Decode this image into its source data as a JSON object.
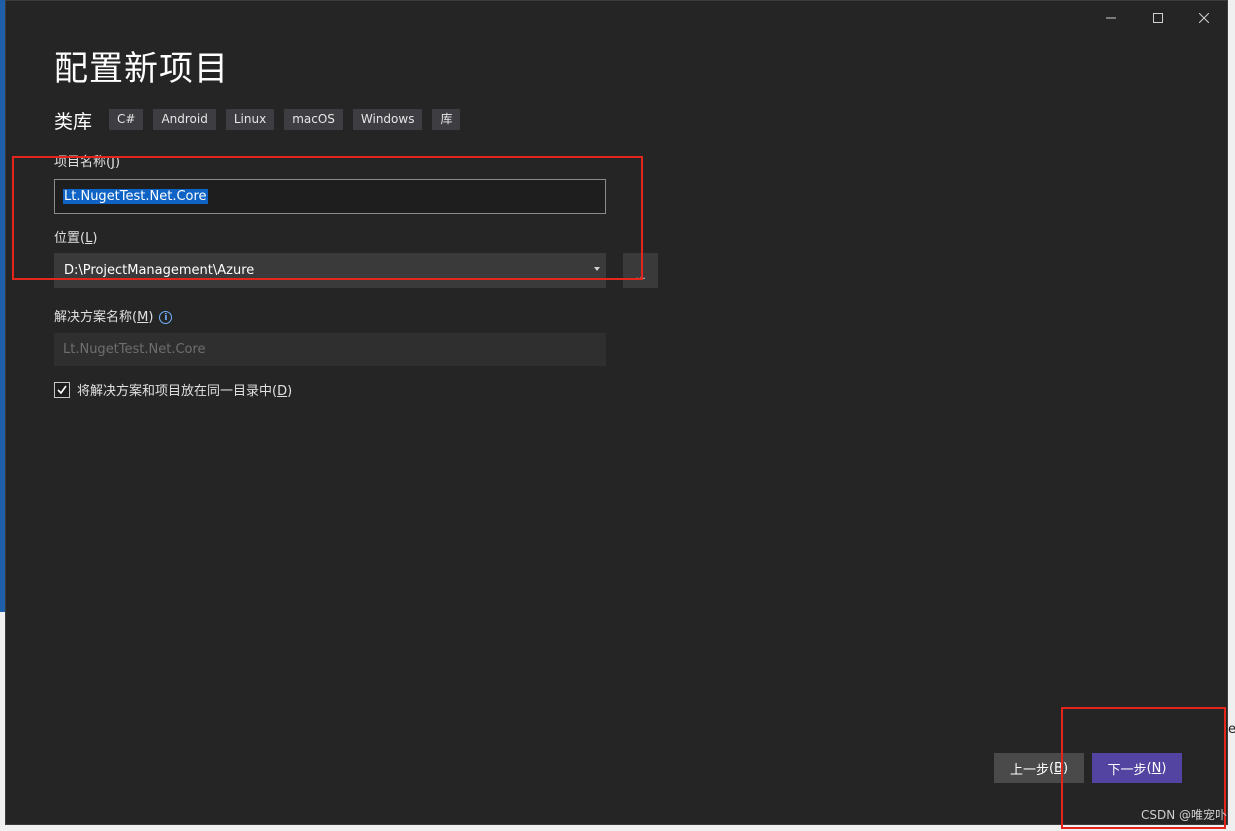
{
  "window": {
    "title": "配置新项目",
    "subtitle": "类库",
    "tags": [
      "C#",
      "Android",
      "Linux",
      "macOS",
      "Windows",
      "库"
    ]
  },
  "caption_buttons": {
    "minimize": "—",
    "maximize": "☐",
    "close": "✕"
  },
  "project_name": {
    "label": "项目名称",
    "mnemonic": "J",
    "value": "Lt.NugetTest.Net.Core"
  },
  "location": {
    "label": "位置",
    "mnemonic": "L",
    "value": "D:\\ProjectManagement\\Azure",
    "browse_label": "..."
  },
  "solution_name": {
    "label": "解决方案名称",
    "mnemonic": "M",
    "value": "Lt.NugetTest.Net.Core",
    "info_glyph": "i"
  },
  "same_directory": {
    "label": "将解决方案和项目放在同一目录中",
    "mnemonic": "D",
    "checked": true
  },
  "buttons": {
    "back_label": "上一步",
    "back_mnemonic": "B",
    "next_label": "下一步",
    "next_mnemonic": "N"
  },
  "desktop_edge_text": "e",
  "watermark": "CSDN @唯宠卟",
  "colors": {
    "window_bg": "#252526",
    "accent": "#5244a0",
    "selection": "#0e63c4",
    "annotation_red": "#e3261c"
  }
}
